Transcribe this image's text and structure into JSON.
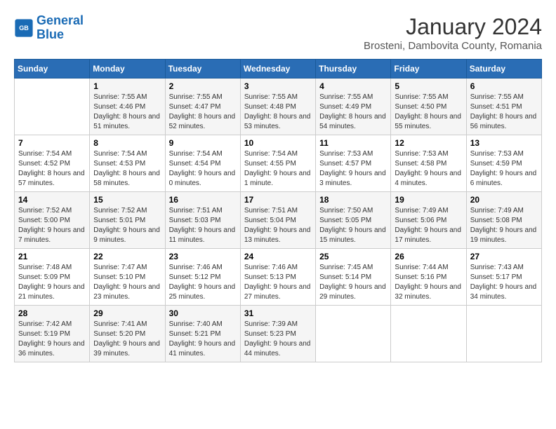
{
  "header": {
    "logo_line1": "General",
    "logo_line2": "Blue",
    "month": "January 2024",
    "location": "Brosteni, Dambovita County, Romania"
  },
  "columns": [
    "Sunday",
    "Monday",
    "Tuesday",
    "Wednesday",
    "Thursday",
    "Friday",
    "Saturday"
  ],
  "weeks": [
    [
      {
        "num": "",
        "sunrise": "",
        "sunset": "",
        "daylight": ""
      },
      {
        "num": "1",
        "sunrise": "Sunrise: 7:55 AM",
        "sunset": "Sunset: 4:46 PM",
        "daylight": "Daylight: 8 hours and 51 minutes."
      },
      {
        "num": "2",
        "sunrise": "Sunrise: 7:55 AM",
        "sunset": "Sunset: 4:47 PM",
        "daylight": "Daylight: 8 hours and 52 minutes."
      },
      {
        "num": "3",
        "sunrise": "Sunrise: 7:55 AM",
        "sunset": "Sunset: 4:48 PM",
        "daylight": "Daylight: 8 hours and 53 minutes."
      },
      {
        "num": "4",
        "sunrise": "Sunrise: 7:55 AM",
        "sunset": "Sunset: 4:49 PM",
        "daylight": "Daylight: 8 hours and 54 minutes."
      },
      {
        "num": "5",
        "sunrise": "Sunrise: 7:55 AM",
        "sunset": "Sunset: 4:50 PM",
        "daylight": "Daylight: 8 hours and 55 minutes."
      },
      {
        "num": "6",
        "sunrise": "Sunrise: 7:55 AM",
        "sunset": "Sunset: 4:51 PM",
        "daylight": "Daylight: 8 hours and 56 minutes."
      }
    ],
    [
      {
        "num": "7",
        "sunrise": "Sunrise: 7:54 AM",
        "sunset": "Sunset: 4:52 PM",
        "daylight": "Daylight: 8 hours and 57 minutes."
      },
      {
        "num": "8",
        "sunrise": "Sunrise: 7:54 AM",
        "sunset": "Sunset: 4:53 PM",
        "daylight": "Daylight: 8 hours and 58 minutes."
      },
      {
        "num": "9",
        "sunrise": "Sunrise: 7:54 AM",
        "sunset": "Sunset: 4:54 PM",
        "daylight": "Daylight: 9 hours and 0 minutes."
      },
      {
        "num": "10",
        "sunrise": "Sunrise: 7:54 AM",
        "sunset": "Sunset: 4:55 PM",
        "daylight": "Daylight: 9 hours and 1 minute."
      },
      {
        "num": "11",
        "sunrise": "Sunrise: 7:53 AM",
        "sunset": "Sunset: 4:57 PM",
        "daylight": "Daylight: 9 hours and 3 minutes."
      },
      {
        "num": "12",
        "sunrise": "Sunrise: 7:53 AM",
        "sunset": "Sunset: 4:58 PM",
        "daylight": "Daylight: 9 hours and 4 minutes."
      },
      {
        "num": "13",
        "sunrise": "Sunrise: 7:53 AM",
        "sunset": "Sunset: 4:59 PM",
        "daylight": "Daylight: 9 hours and 6 minutes."
      }
    ],
    [
      {
        "num": "14",
        "sunrise": "Sunrise: 7:52 AM",
        "sunset": "Sunset: 5:00 PM",
        "daylight": "Daylight: 9 hours and 7 minutes."
      },
      {
        "num": "15",
        "sunrise": "Sunrise: 7:52 AM",
        "sunset": "Sunset: 5:01 PM",
        "daylight": "Daylight: 9 hours and 9 minutes."
      },
      {
        "num": "16",
        "sunrise": "Sunrise: 7:51 AM",
        "sunset": "Sunset: 5:03 PM",
        "daylight": "Daylight: 9 hours and 11 minutes."
      },
      {
        "num": "17",
        "sunrise": "Sunrise: 7:51 AM",
        "sunset": "Sunset: 5:04 PM",
        "daylight": "Daylight: 9 hours and 13 minutes."
      },
      {
        "num": "18",
        "sunrise": "Sunrise: 7:50 AM",
        "sunset": "Sunset: 5:05 PM",
        "daylight": "Daylight: 9 hours and 15 minutes."
      },
      {
        "num": "19",
        "sunrise": "Sunrise: 7:49 AM",
        "sunset": "Sunset: 5:06 PM",
        "daylight": "Daylight: 9 hours and 17 minutes."
      },
      {
        "num": "20",
        "sunrise": "Sunrise: 7:49 AM",
        "sunset": "Sunset: 5:08 PM",
        "daylight": "Daylight: 9 hours and 19 minutes."
      }
    ],
    [
      {
        "num": "21",
        "sunrise": "Sunrise: 7:48 AM",
        "sunset": "Sunset: 5:09 PM",
        "daylight": "Daylight: 9 hours and 21 minutes."
      },
      {
        "num": "22",
        "sunrise": "Sunrise: 7:47 AM",
        "sunset": "Sunset: 5:10 PM",
        "daylight": "Daylight: 9 hours and 23 minutes."
      },
      {
        "num": "23",
        "sunrise": "Sunrise: 7:46 AM",
        "sunset": "Sunset: 5:12 PM",
        "daylight": "Daylight: 9 hours and 25 minutes."
      },
      {
        "num": "24",
        "sunrise": "Sunrise: 7:46 AM",
        "sunset": "Sunset: 5:13 PM",
        "daylight": "Daylight: 9 hours and 27 minutes."
      },
      {
        "num": "25",
        "sunrise": "Sunrise: 7:45 AM",
        "sunset": "Sunset: 5:14 PM",
        "daylight": "Daylight: 9 hours and 29 minutes."
      },
      {
        "num": "26",
        "sunrise": "Sunrise: 7:44 AM",
        "sunset": "Sunset: 5:16 PM",
        "daylight": "Daylight: 9 hours and 32 minutes."
      },
      {
        "num": "27",
        "sunrise": "Sunrise: 7:43 AM",
        "sunset": "Sunset: 5:17 PM",
        "daylight": "Daylight: 9 hours and 34 minutes."
      }
    ],
    [
      {
        "num": "28",
        "sunrise": "Sunrise: 7:42 AM",
        "sunset": "Sunset: 5:19 PM",
        "daylight": "Daylight: 9 hours and 36 minutes."
      },
      {
        "num": "29",
        "sunrise": "Sunrise: 7:41 AM",
        "sunset": "Sunset: 5:20 PM",
        "daylight": "Daylight: 9 hours and 39 minutes."
      },
      {
        "num": "30",
        "sunrise": "Sunrise: 7:40 AM",
        "sunset": "Sunset: 5:21 PM",
        "daylight": "Daylight: 9 hours and 41 minutes."
      },
      {
        "num": "31",
        "sunrise": "Sunrise: 7:39 AM",
        "sunset": "Sunset: 5:23 PM",
        "daylight": "Daylight: 9 hours and 44 minutes."
      },
      {
        "num": "",
        "sunrise": "",
        "sunset": "",
        "daylight": ""
      },
      {
        "num": "",
        "sunrise": "",
        "sunset": "",
        "daylight": ""
      },
      {
        "num": "",
        "sunrise": "",
        "sunset": "",
        "daylight": ""
      }
    ]
  ]
}
